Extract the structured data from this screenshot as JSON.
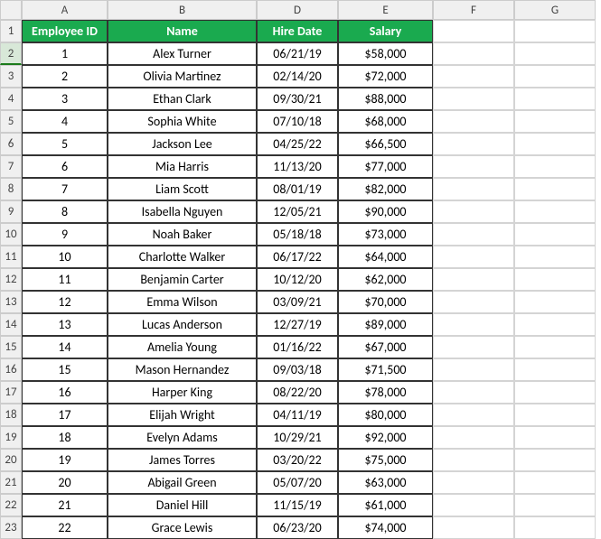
{
  "columns": [
    "A",
    "B",
    "D",
    "E",
    "F",
    "G"
  ],
  "headers": {
    "A": "Employee ID",
    "B": "Name",
    "D": "Hire Date",
    "E": "Salary"
  },
  "row_head_selected": 2,
  "rows": [
    {
      "n": 1,
      "id": "1",
      "name": "Alex Turner",
      "date": "06/21/19",
      "salary": "$58,000"
    },
    {
      "n": 2,
      "id": "2",
      "name": "Olivia Martinez",
      "date": "02/14/20",
      "salary": "$72,000"
    },
    {
      "n": 3,
      "id": "3",
      "name": "Ethan Clark",
      "date": "09/30/21",
      "salary": "$88,000"
    },
    {
      "n": 4,
      "id": "4",
      "name": "Sophia White",
      "date": "07/10/18",
      "salary": "$68,000"
    },
    {
      "n": 5,
      "id": "5",
      "name": "Jackson Lee",
      "date": "04/25/22",
      "salary": "$66,500"
    },
    {
      "n": 6,
      "id": "6",
      "name": "Mia Harris",
      "date": "11/13/20",
      "salary": "$77,000"
    },
    {
      "n": 7,
      "id": "7",
      "name": "Liam Scott",
      "date": "08/01/19",
      "salary": "$82,000"
    },
    {
      "n": 8,
      "id": "8",
      "name": "Isabella Nguyen",
      "date": "12/05/21",
      "salary": "$90,000"
    },
    {
      "n": 9,
      "id": "9",
      "name": "Noah Baker",
      "date": "05/18/18",
      "salary": "$73,000"
    },
    {
      "n": 10,
      "id": "10",
      "name": "Charlotte Walker",
      "date": "06/17/22",
      "salary": "$64,000"
    },
    {
      "n": 11,
      "id": "11",
      "name": "Benjamin Carter",
      "date": "10/12/20",
      "salary": "$62,000"
    },
    {
      "n": 12,
      "id": "12",
      "name": "Emma Wilson",
      "date": "03/09/21",
      "salary": "$70,000"
    },
    {
      "n": 13,
      "id": "13",
      "name": "Lucas Anderson",
      "date": "12/27/19",
      "salary": "$89,000"
    },
    {
      "n": 14,
      "id": "14",
      "name": "Amelia Young",
      "date": "01/16/22",
      "salary": "$67,000"
    },
    {
      "n": 15,
      "id": "15",
      "name": "Mason Hernandez",
      "date": "09/03/18",
      "salary": "$71,500"
    },
    {
      "n": 16,
      "id": "16",
      "name": "Harper King",
      "date": "08/22/20",
      "salary": "$78,000"
    },
    {
      "n": 17,
      "id": "17",
      "name": "Elijah Wright",
      "date": "04/11/19",
      "salary": "$80,000"
    },
    {
      "n": 18,
      "id": "18",
      "name": "Evelyn Adams",
      "date": "10/29/21",
      "salary": "$92,000"
    },
    {
      "n": 19,
      "id": "19",
      "name": "James Torres",
      "date": "03/20/22",
      "salary": "$75,000"
    },
    {
      "n": 20,
      "id": "20",
      "name": "Abigail Green",
      "date": "05/07/20",
      "salary": "$63,000"
    },
    {
      "n": 21,
      "id": "21",
      "name": "Daniel Hill",
      "date": "11/15/19",
      "salary": "$61,000"
    },
    {
      "n": 22,
      "id": "22",
      "name": "Grace Lewis",
      "date": "06/23/20",
      "salary": "$74,000"
    }
  ]
}
